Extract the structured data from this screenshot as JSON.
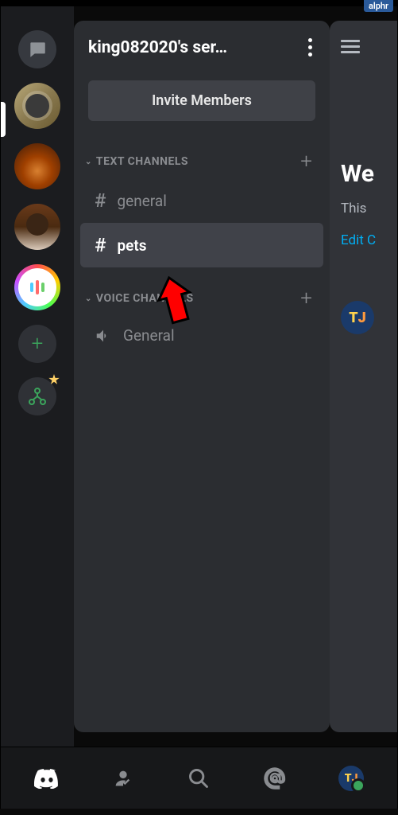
{
  "watermark": "alphr",
  "server_name": "king082020's ser…",
  "invite_label": "Invite Members",
  "categories": {
    "text": {
      "label": "TEXT CHANNELS"
    },
    "voice": {
      "label": "VOICE CHANNELS"
    }
  },
  "channels": {
    "general_text": "general",
    "pets": "pets",
    "general_voice": "General"
  },
  "right_peek": {
    "welcome": "We",
    "subtitle": "This",
    "edit_link": "Edit C"
  },
  "nav_badge": {
    "t": "T",
    "j": "J"
  }
}
